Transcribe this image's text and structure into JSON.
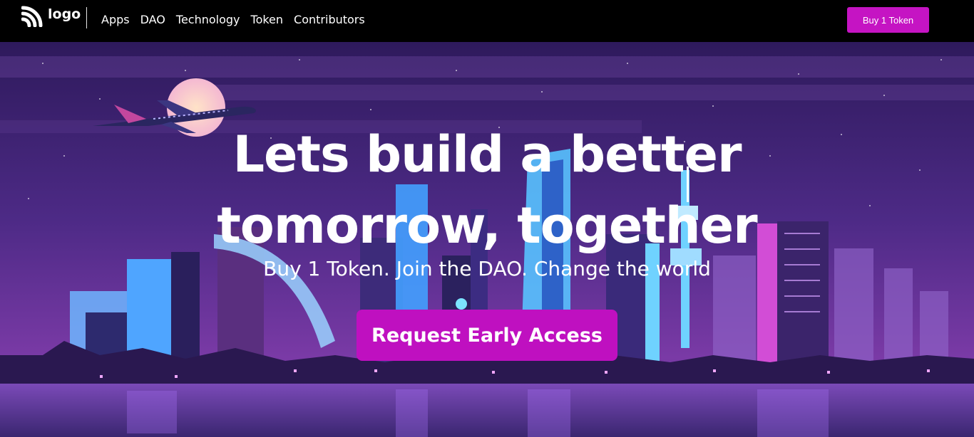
{
  "nav": {
    "logo_text": "logo",
    "links": [
      "Apps",
      "DAO",
      "Technology",
      "Token",
      "Contributors"
    ],
    "buy_label": "Buy 1 Token"
  },
  "hero": {
    "title_line1": "Lets build a better",
    "title_line2": "tomorrow, together",
    "subtitle": "Buy 1 Token. Join the DAO. Change the world",
    "cta_label": "Request Early Access"
  },
  "colors": {
    "accent": "#c514c3",
    "nav_bg": "#000000",
    "sky_top": "#3a1f6b",
    "sky_bottom": "#7b3aa8"
  }
}
